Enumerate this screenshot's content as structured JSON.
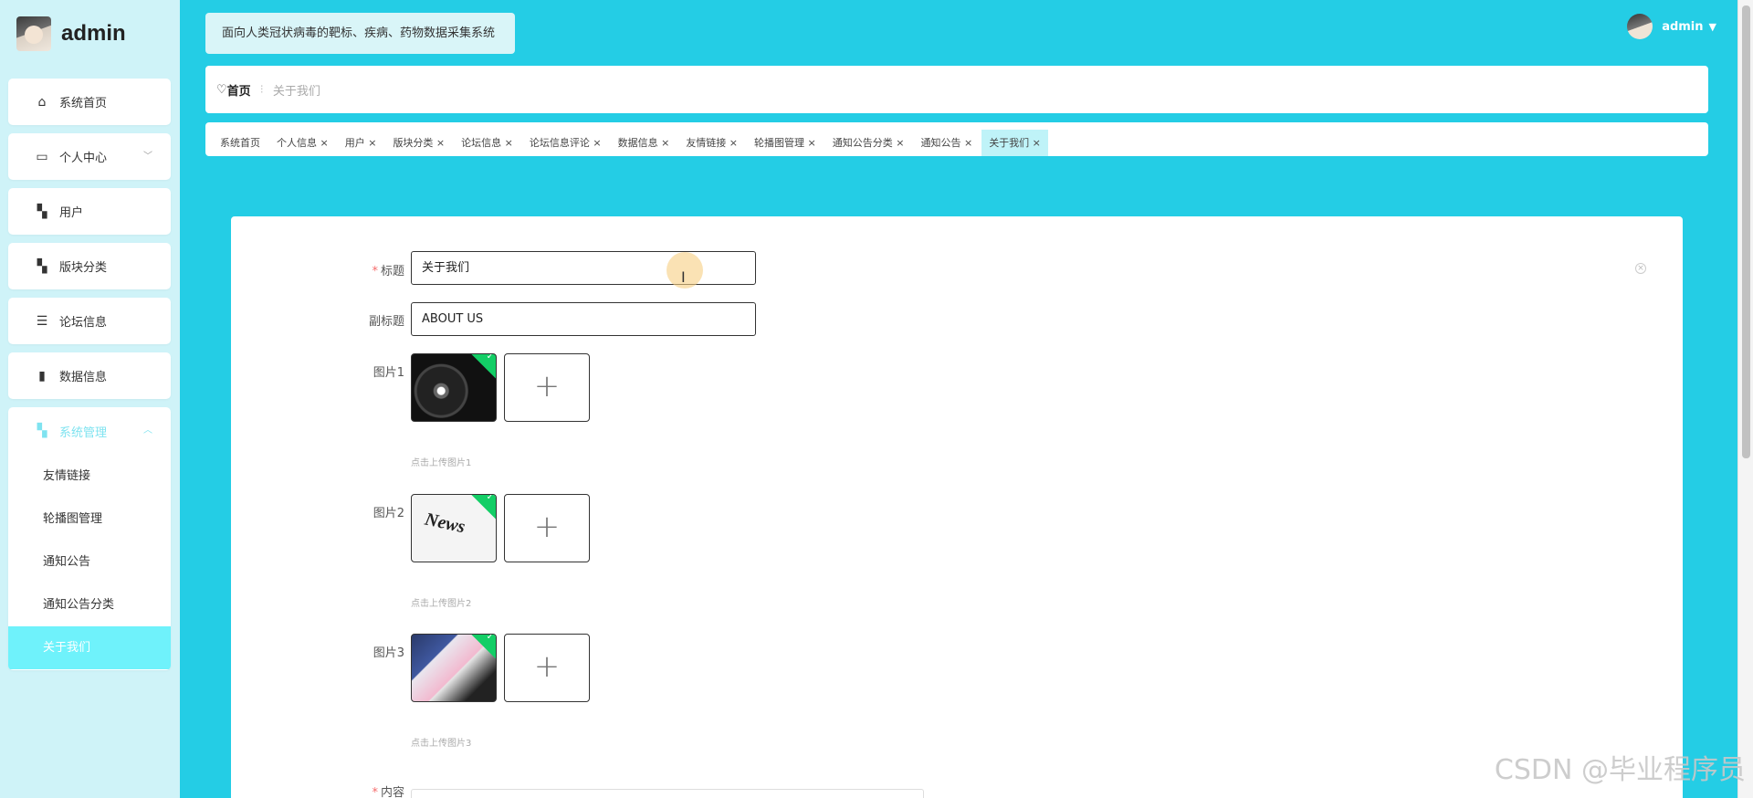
{
  "user": {
    "name": "admin"
  },
  "header": {
    "app_title": "面向人类冠状病毒的靶标、疾病、药物数据采集系统"
  },
  "sidebar": {
    "items": [
      {
        "label": "系统首页",
        "icon": "home-icon"
      },
      {
        "label": "个人中心",
        "icon": "id-card-icon"
      },
      {
        "label": "用户",
        "icon": "grid-icon"
      },
      {
        "label": "版块分类",
        "icon": "grid-icon"
      },
      {
        "label": "论坛信息",
        "icon": "sliders-icon"
      },
      {
        "label": "数据信息",
        "icon": "book-icon"
      }
    ],
    "system": {
      "label": "系统管理",
      "subitems": [
        "友情链接",
        "轮播图管理",
        "通知公告",
        "通知公告分类",
        "关于我们"
      ]
    }
  },
  "breadcrumb": {
    "home": "首页",
    "current": "关于我们"
  },
  "tabs": [
    "系统首页",
    "个人信息 ×",
    "用户 ×",
    "版块分类 ×",
    "论坛信息 ×",
    "论坛信息评论 ×",
    "数据信息 ×",
    "友情链接 ×",
    "轮播图管理 ×",
    "通知公告分类 ×",
    "通知公告 ×",
    "关于我们 ×"
  ],
  "form": {
    "title_label": "标题",
    "title_value": "关于我们",
    "subtitle_label": "副标题",
    "subtitle_value": "ABOUT US",
    "image1_label": "图片1",
    "image1_hint": "点击上传图片1",
    "image2_label": "图片2",
    "image2_hint": "点击上传图片2",
    "image2_text": "News",
    "image3_label": "图片3",
    "image3_hint": "点击上传图片3",
    "content_label": "内容"
  },
  "watermark": "CSDN @毕业程序员"
}
